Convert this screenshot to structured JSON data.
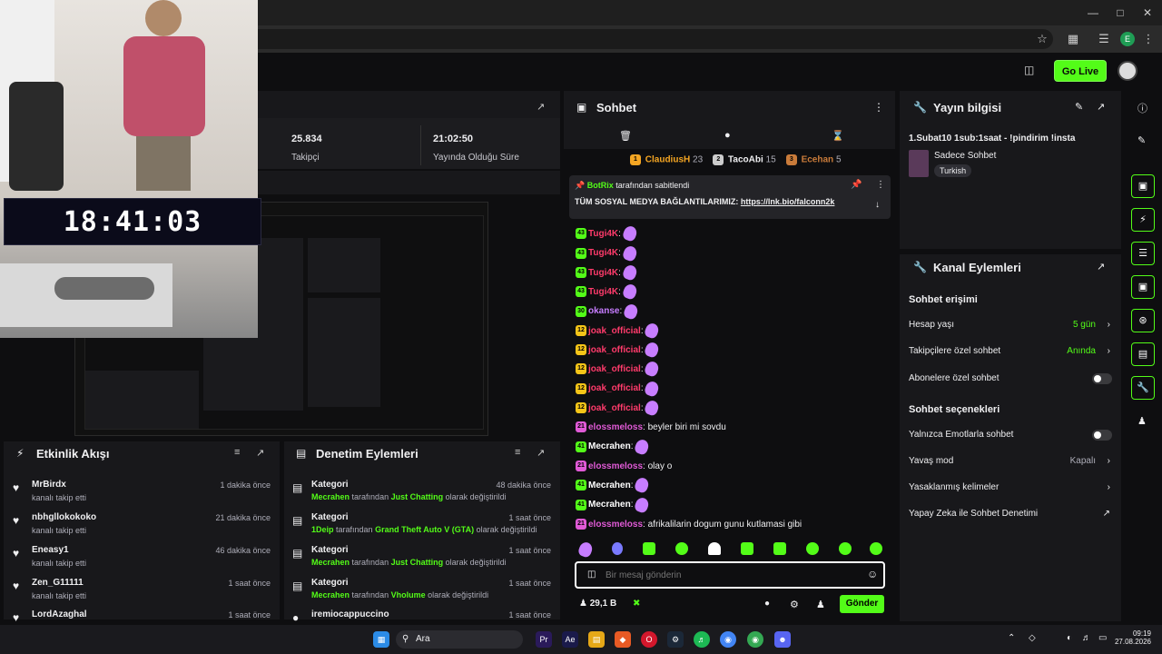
{
  "header": {
    "go_live_label": "Go Live"
  },
  "stats": [
    {
      "value": "25.834",
      "label": "Takipçi"
    },
    {
      "value": "21:02:50",
      "label": "Yayında Olduğu Süre"
    }
  ],
  "overlay_clock": "18:41:03",
  "activity": {
    "title": "Etkinlik Akışı",
    "items": [
      {
        "name": "MrBirdx",
        "action": "kanalı takip etti",
        "time": "1 dakika önce"
      },
      {
        "name": "nbhgllokokoko",
        "action": "kanalı takip etti",
        "time": "21 dakika önce"
      },
      {
        "name": "Eneasy1",
        "action": "kanalı takip etti",
        "time": "46 dakika önce"
      },
      {
        "name": "Zen_G11111",
        "action": "kanalı takip etti",
        "time": "1 saat önce"
      },
      {
        "name": "LordAzaghal",
        "action": "",
        "time": "1 saat önce"
      }
    ]
  },
  "moderation": {
    "title": "Denetim Eylemleri",
    "items": [
      {
        "title": "Kategori",
        "user": "Mecrahen",
        "mid": "tarafından",
        "category": "Just Chatting",
        "suffix": "olarak değiştirildi",
        "time": "48 dakika önce"
      },
      {
        "title": "Kategori",
        "user": "1Deip",
        "mid": "tarafından",
        "category": "Grand Theft Auto V (GTA)",
        "suffix": "olarak değiştirildi",
        "time": "1 saat önce"
      },
      {
        "title": "Kategori",
        "user": "Mecrahen",
        "mid": "tarafından",
        "category": "Just Chatting",
        "suffix": "olarak değiştirildi",
        "time": "1 saat önce"
      },
      {
        "title": "Kategori",
        "user": "Mecrahen",
        "mid": "tarafından",
        "category": "Vholume",
        "suffix": "olarak değiştirildi",
        "time": "1 saat önce"
      },
      {
        "title": "iremiocappuccino",
        "user": "",
        "mid": "",
        "category": "",
        "suffix": "",
        "time": "1 saat önce"
      }
    ]
  },
  "chat": {
    "title": "Sohbet",
    "top_gifters": [
      {
        "name": "ClaudiusH",
        "count": "23",
        "rank": "1"
      },
      {
        "name": "TacoAbi",
        "count": "15",
        "rank": "2"
      },
      {
        "name": "Ecehan",
        "count": "5",
        "rank": "3"
      }
    ],
    "pinned_by": "BotRix",
    "pinned_suffix": "tarafından sabitlendi",
    "pinned_text": "TÜM SOSYAL MEDYA BAĞLANTILARIMIZ:",
    "pinned_link": "https://lnk.bio/falconn2k",
    "messages": [
      {
        "badge": "43",
        "user": "Tugi4K",
        "text": "",
        "color": "#ff3b6b",
        "emote": true
      },
      {
        "badge": "43",
        "user": "Tugi4K",
        "text": "",
        "color": "#ff3b6b",
        "emote": true
      },
      {
        "badge": "43",
        "user": "Tugi4K",
        "text": "",
        "color": "#ff3b6b",
        "emote": true
      },
      {
        "badge": "43",
        "user": "Tugi4K",
        "text": "",
        "color": "#ff3b6b",
        "emote": true
      },
      {
        "badge": "30",
        "user": "okanse",
        "text": "",
        "color": "#c77dff",
        "emote": true
      },
      {
        "badge": "12",
        "user": "joak_official",
        "text": "",
        "color": "#ff3b6b",
        "emote": true
      },
      {
        "badge": "12",
        "user": "joak_official",
        "text": "",
        "color": "#ff3b6b",
        "emote": true
      },
      {
        "badge": "12",
        "user": "joak_official",
        "text": "",
        "color": "#ff3b6b",
        "emote": true
      },
      {
        "badge": "12",
        "user": "joak_official",
        "text": "",
        "color": "#ff3b6b",
        "emote": true
      },
      {
        "badge": "12",
        "user": "joak_official",
        "text": "",
        "color": "#ff3b6b",
        "emote": true
      },
      {
        "badge": "21",
        "user": "elossmeloss",
        "text": "beyler biri mi sovdu",
        "color": "#e05ad6",
        "emote": false
      },
      {
        "badge": "41",
        "user": "Mecrahen",
        "text": "",
        "color": "#ffffff",
        "emote": true
      },
      {
        "badge": "21",
        "user": "elossmeloss",
        "text": "olay o",
        "color": "#e05ad6",
        "emote": false
      },
      {
        "badge": "41",
        "user": "Mecrahen",
        "text": "",
        "color": "#ffffff",
        "emote": true
      },
      {
        "badge": "41",
        "user": "Mecrahen",
        "text": "",
        "color": "#ffffff",
        "emote": true
      },
      {
        "badge": "21",
        "user": "elossmeloss",
        "text": "afrikalilarin dogum gunu kutlamasi gibi",
        "color": "#e05ad6",
        "emote": false
      }
    ],
    "input_placeholder": "Bir mesaj gönderin",
    "viewer_count": "29,1 B",
    "send_label": "Gönder"
  },
  "stream_info": {
    "title": "Yayın bilgisi",
    "stream_title": "1.Subat10 1sub:1saat - !pindirim !insta",
    "category": "Sadece Sohbet",
    "tag": "Turkish"
  },
  "channel_actions": {
    "title": "Kanal Eylemleri",
    "chat_access_heading": "Sohbet erişimi",
    "account_age_label": "Hesap yaşı",
    "account_age_value": "5 gün",
    "followers_only_label": "Takipçilere özel sohbet",
    "followers_only_value": "Anında",
    "subscribers_only_label": "Abonelere özel sohbet",
    "chat_options_heading": "Sohbet seçenekleri",
    "emotes_only_label": "Yalnızca Emotlarla sohbet",
    "slow_mode_label": "Yavaş mod",
    "slow_mode_value": "Kapalı",
    "banned_words_label": "Yasaklanmış kelimeler",
    "ai_moderation_label": "Yapay Zeka ile Sohbet Denetimi"
  },
  "taskbar": {
    "search_label": "Ara",
    "time": "09:19",
    "date": "27.08.2026"
  },
  "colors": {
    "accent": "#53fc18",
    "panel": "#18181b",
    "background": "#0e0e10"
  }
}
